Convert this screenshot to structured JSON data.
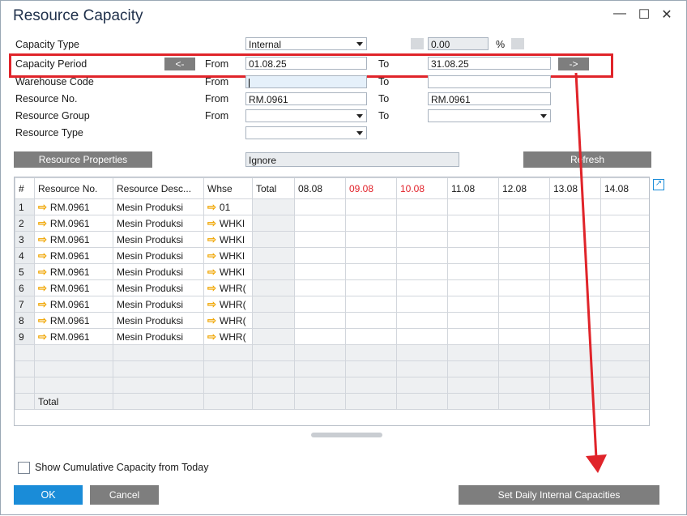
{
  "window": {
    "title": "Resource Capacity",
    "minimize": "—",
    "maximize": "☐",
    "close": "✕"
  },
  "form": {
    "capacity_type_label": "Capacity Type",
    "capacity_type_value": "Internal",
    "percent_value": "0.00",
    "percent_symbol": "%",
    "capacity_period_label": "Capacity Period",
    "prev_btn": "<-",
    "next_btn": "->",
    "from_label": "From",
    "to_label": "To",
    "period_from": "01.08.25",
    "period_to": "31.08.25",
    "warehouse_label": "Warehouse Code",
    "resource_no_label": "Resource No.",
    "resource_from": "RM.0961",
    "resource_to": "RM.0961",
    "resource_group_label": "Resource Group",
    "resource_type_label": "Resource Type",
    "resource_properties_btn": "Resource Properties",
    "ignore_value": "Ignore",
    "refresh_btn": "Refresh"
  },
  "grid": {
    "headers": [
      "#",
      "Resource No.",
      "Resource Desc...",
      "Whse",
      "Total",
      "08.08",
      "09.08",
      "10.08",
      "11.08",
      "12.08",
      "13.08",
      "14.08"
    ],
    "rows": [
      {
        "num": "1",
        "res": "RM.0961",
        "desc": "Mesin Produksi",
        "whse": "01"
      },
      {
        "num": "2",
        "res": "RM.0961",
        "desc": "Mesin Produksi",
        "whse": "WHKI"
      },
      {
        "num": "3",
        "res": "RM.0961",
        "desc": "Mesin Produksi",
        "whse": "WHKI"
      },
      {
        "num": "4",
        "res": "RM.0961",
        "desc": "Mesin Produksi",
        "whse": "WHKI"
      },
      {
        "num": "5",
        "res": "RM.0961",
        "desc": "Mesin Produksi",
        "whse": "WHKI"
      },
      {
        "num": "6",
        "res": "RM.0961",
        "desc": "Mesin Produksi",
        "whse": "WHR("
      },
      {
        "num": "7",
        "res": "RM.0961",
        "desc": "Mesin Produksi",
        "whse": "WHR("
      },
      {
        "num": "8",
        "res": "RM.0961",
        "desc": "Mesin Produksi",
        "whse": "WHR("
      },
      {
        "num": "9",
        "res": "RM.0961",
        "desc": "Mesin Produksi",
        "whse": "WHR("
      }
    ],
    "total_label": "Total"
  },
  "footer": {
    "cumulative_label": "Show Cumulative Capacity from Today",
    "ok_btn": "OK",
    "cancel_btn": "Cancel",
    "set_daily_btn": "Set Daily Internal Capacities"
  },
  "colors": {
    "accent": "#1a8cd8",
    "annotation": "#e0242a",
    "weekend": "#e2232b"
  }
}
